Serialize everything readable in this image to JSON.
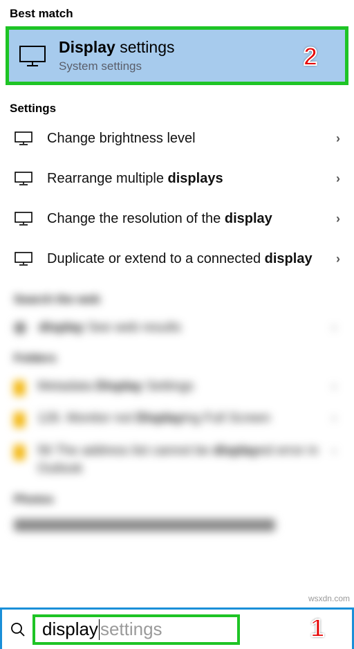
{
  "headers": {
    "best_match": "Best match",
    "settings": "Settings"
  },
  "best_match": {
    "title_bold": "Display",
    "title_rest": " settings",
    "subtitle": "System settings"
  },
  "settings_results": [
    {
      "text": "Change brightness level"
    },
    {
      "text_pre": "Rearrange multiple ",
      "bold": "displays"
    },
    {
      "text_pre": "Change the resolution of the ",
      "bold": "display"
    },
    {
      "text_pre": "Duplicate or extend to a connected ",
      "bold": "display"
    }
  ],
  "blurred": {
    "search_web_header": "Search the web",
    "web_row_pre": "display",
    "web_row_rest": "  See web results",
    "folders_header": "Folders",
    "folder1_pre": "Metadata ",
    "folder1_bold": "Display",
    "folder1_post": " Settings",
    "folder2_pre": "126. Monitor not ",
    "folder2_bold": "Display",
    "folder2_post": "ing Full Screen",
    "folder3_pre": "56 The address list cannot be ",
    "folder3_bold": "display",
    "folder3_post": "ed error in Outlook",
    "photos_header": "Photos"
  },
  "search": {
    "typed": "display",
    "suggestion": " settings"
  },
  "badges": {
    "one": "1",
    "two": "2"
  },
  "watermark": "wsxdn.com"
}
